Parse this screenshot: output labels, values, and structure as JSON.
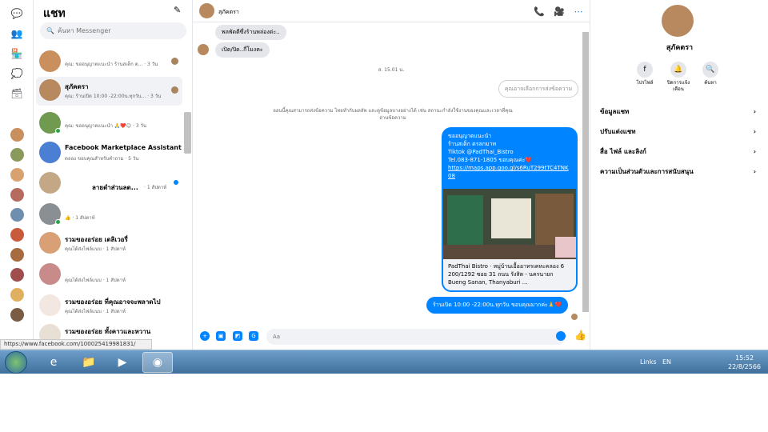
{
  "chatlist": {
    "title": "แชท",
    "search_placeholder": "ค้นหา Messenger",
    "items": [
      {
        "name": "",
        "sub": "คุณ: ขออนุญาตแนะนำ ร้านสเต็ก ต... · 3 วัน"
      },
      {
        "name": "สุภัคตรา",
        "sub": "คุณ: ร้านเปิด 10:00 -22:00น.ทุกวัน... · 3 วัน"
      },
      {
        "name": "",
        "sub": "คุณ: ขออนุญาตแนะนำ 🙏❤️😊 · 3 วัน"
      },
      {
        "name": "Facebook Marketplace Assistant",
        "sub": "ดลอง ขอบคุณสำหรับคำถาม · 5 วัน"
      },
      {
        "name": "ลายดำส่วนลด...",
        "sub": "· 1 สัปดาห์"
      },
      {
        "name": "",
        "sub": "👍 · 1 สัปดาห์"
      },
      {
        "name": "รวมของอร่อย เดลิเวอรี่",
        "sub": "คุณได้ส่งไฟล์แนบ · 1 สัปดาห์"
      },
      {
        "name": "",
        "sub": "คุณได้ส่งไฟล์แนบ · 1 สัปดาห์"
      },
      {
        "name": "รวมของอร่อย ที่คุณอาจจะพลาดไป",
        "sub": "คุณได้ส่งไฟล์แนบ · 1 สัปดาห์"
      },
      {
        "name": "รวมของอร่อย ทั้งคาวและหวาน",
        "sub": ""
      }
    ]
  },
  "conversation": {
    "contact_name": "สุภัคตรา",
    "messages_in": [
      "พลพัดดีซึ่งร้านพล่องต่ะ..",
      "เปิด/ปิด..กี่โมงคะ"
    ],
    "time_separator": "ส. 15.01 น.",
    "search_placeholder": "คุณอาจเลือกการส่งข้อความ",
    "notice": "ออนนี้คุณสามารถส่งข้อความ ไทยทำกับผลลัพ และดูข้อมูลบางอย่างได้ เช่น สถานะกำลังใช้งานของคุณและเวลาที่คุณอ่านข้อความ",
    "card": {
      "line1": "ขออนุญาตแนะนำ",
      "line2": "ร้านสเต็ก ดรลกมาท",
      "line3": "Tiktok @PadThai_Bistro",
      "line4": "Tel.083-871-1805 ขอบคุณค่ะ❤️",
      "url": "https://maps.app.goo.gl/s6RuT299tTC4TNK08",
      "preview_title": "PadThai Bistro · หมู่บ้านเอื้ออาทรเคหะคลอง 6 200/1292 ซอย 31 ถนน รังสิต - นครนายก Bueng Sanan, Thanyaburi ..."
    },
    "message_out_last": "ร้านเปิด 10:00 -22:00น.ทุกวัน ขอบคุณมากค่ะ🙏❤️",
    "composer_placeholder": "Aa"
  },
  "info": {
    "name": "สุภัคตรา",
    "actions": [
      "โปรไฟล์",
      "ปิดการแจ้งเตือน",
      "ค้นหา"
    ],
    "rows": [
      "ข้อมูลแชท",
      "ปรับแต่งแชท",
      "สื่อ ไฟล์ และลิงก์",
      "ความเป็นส่วนตัวและการสนับสนุน"
    ]
  },
  "statusbar": {
    "url": "https://www.facebook.com/100025419981831/"
  },
  "taskbar": {
    "links": "Links",
    "lang": "EN",
    "time": "15:52",
    "date": "22/8/2566"
  },
  "colors": {
    "accent": "#0084ff",
    "bubble_in": "#e4e6eb",
    "online": "#31a24c"
  }
}
